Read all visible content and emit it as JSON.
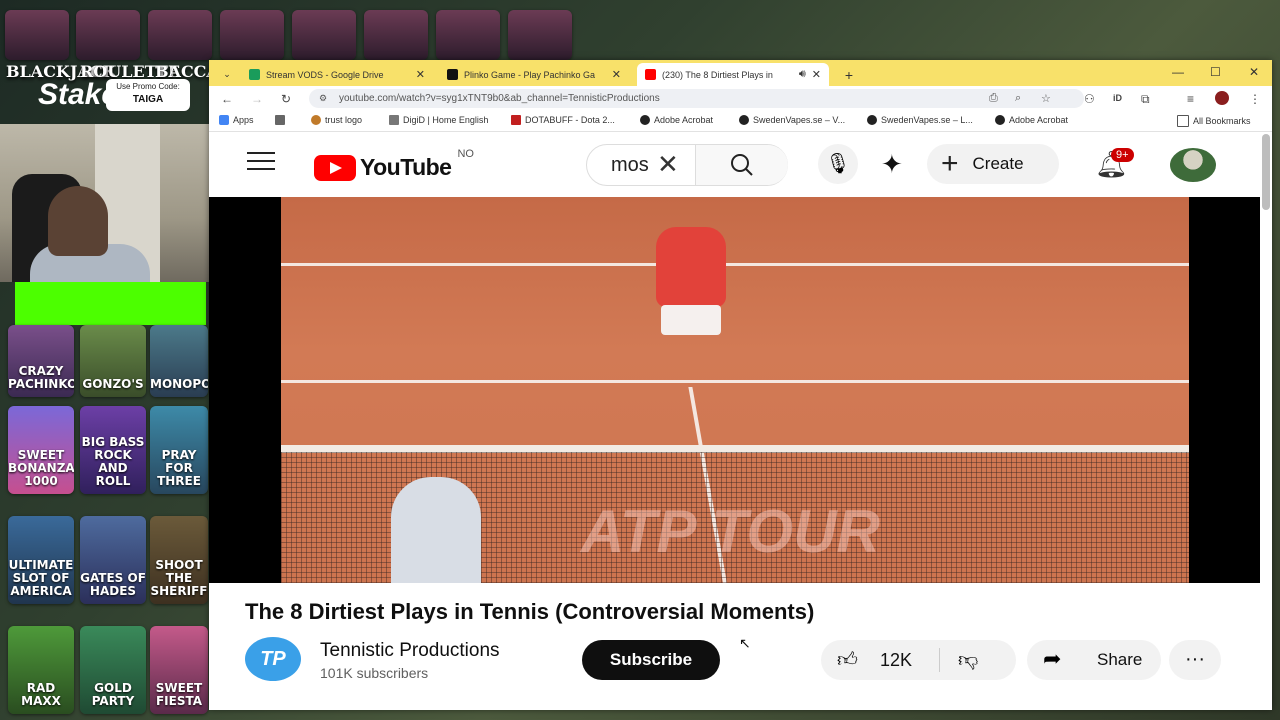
{
  "stream": {
    "casino_labels": [
      "BLACKJACK",
      "ROULETTE",
      "BACCARAT"
    ],
    "brand": "Stake",
    "promo_label": "Use Promo Code:",
    "promo_code": "TAIGA",
    "game_tiles": [
      "CRAZY PACHINKO",
      "GONZO'S",
      "MONOPOLY",
      "SWEET BONANZA 1000",
      "BIG BASS ROCK AND ROLL",
      "PRAY FOR THREE",
      "ULTIMATE SLOT OF AMERICA",
      "GATES OF HADES",
      "SHOOT THE SHERIFF",
      "RAD MAXX",
      "GOLD PARTY",
      "SWEET FIESTA"
    ]
  },
  "browser": {
    "tabs": [
      {
        "title": "Stream VODS - Google Drive",
        "favicon_color": "#1a9c5b"
      },
      {
        "title": "Plinko Game - Play Pachinko Ga",
        "favicon_color": "#111111"
      },
      {
        "title": "(230) The 8 Dirtiest Plays in",
        "favicon_color": "#ff0000"
      }
    ],
    "url": "youtube.com/watch?v=syg1xTNT9b0&ab_channel=TennisticProductions",
    "bookmarks": [
      "Apps",
      "trust logo",
      "DigiD | Home English",
      "DOTABUFF - Dota 2...",
      "Adobe Acrobat",
      "SwedenVapes.se – V...",
      "SwedenVapes.se – L...",
      "Adobe Acrobat",
      "All Bookmarks"
    ]
  },
  "youtube": {
    "logo_text": "YouTube",
    "country": "NO",
    "search_value": "mos",
    "create_label": "Create",
    "notification_count": "9+",
    "video_watermark": "ATP TOUR",
    "video_title": "The 8 Dirtiest Plays in Tennis (Controversial Moments)",
    "channel_initials": "TP",
    "channel_name": "Tennistic Productions",
    "subscribers": "101K subscribers",
    "subscribe_label": "Subscribe",
    "likes": "12K",
    "share_label": "Share"
  },
  "colors": {
    "accent": "#ff0000",
    "tabstrip": "#f8e16a",
    "greenscreen": "#4cff00"
  }
}
